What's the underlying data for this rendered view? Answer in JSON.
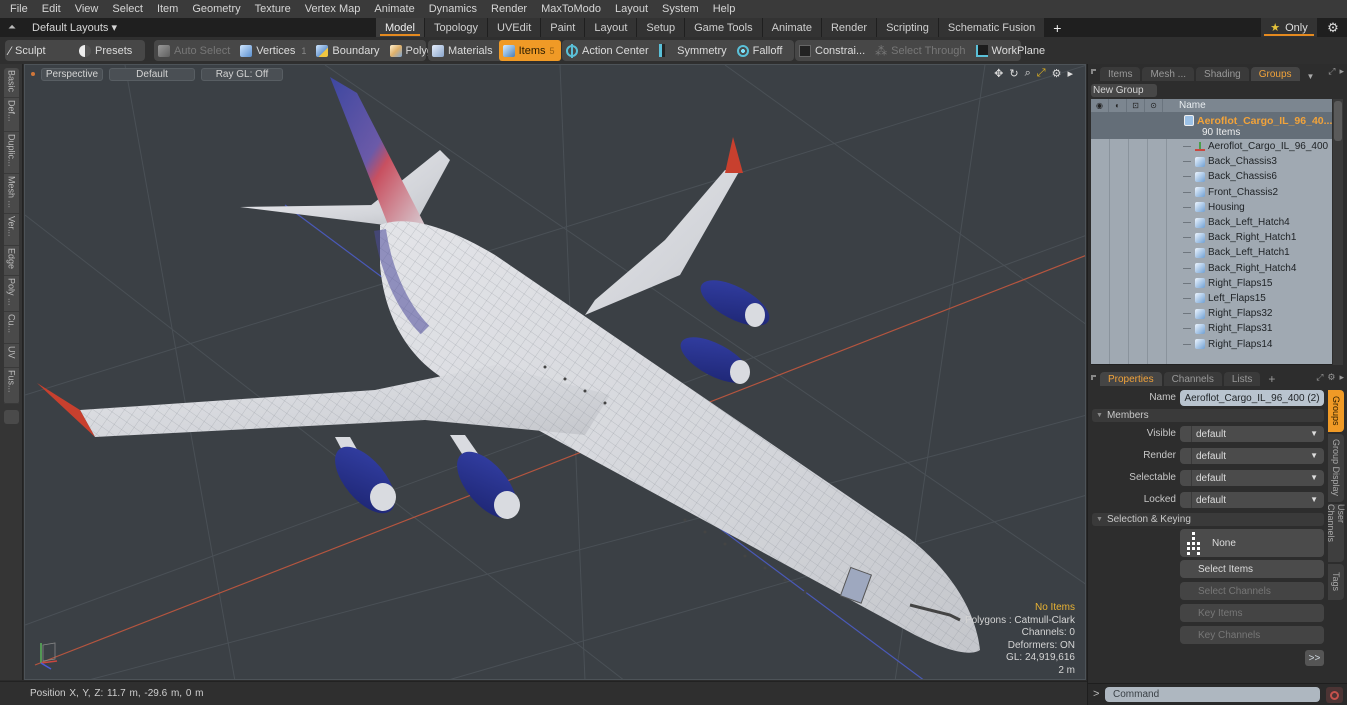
{
  "menu": [
    "File",
    "Edit",
    "View",
    "Select",
    "Item",
    "Geometry",
    "Texture",
    "Vertex Map",
    "Animate",
    "Dynamics",
    "Render",
    "MaxToModo",
    "Layout",
    "System",
    "Help"
  ],
  "layout_bar": {
    "layouts_label": "Default Layouts ▾",
    "tabs": [
      "Model",
      "Topology",
      "UVEdit",
      "Paint",
      "Layout",
      "Setup",
      "Game Tools",
      "Animate",
      "Render",
      "Scripting",
      "Schematic Fusion"
    ],
    "active_tab": "Model",
    "add_label": "+",
    "only_label": "Only",
    "accent_color": "#e58a1f"
  },
  "toolbar": {
    "sculpt": "Sculpt",
    "presets": "Presets",
    "auto_select": "Auto Select",
    "vertices": "Vertices",
    "vertices_count": "1",
    "boundary": "Boundary",
    "polygons": "Polygons",
    "materials": "Materials",
    "items": "Items",
    "items_count": "5",
    "action_center": "Action Center",
    "symmetry": "Symmetry",
    "falloff": "Falloff",
    "constraints": "Constrai...",
    "select_through": "Select Through",
    "workplane": "WorkPlane"
  },
  "left_tabs": [
    "Basic",
    "Def...",
    "Duplic...",
    "Mesh ...",
    "Ver...",
    "Edge",
    "Poly ...",
    "Cu...",
    "UV",
    "Fus..."
  ],
  "viewport": {
    "view_mode": "Perspective",
    "shading": "Default",
    "raygl": "Ray GL: Off",
    "info": {
      "selection": "No Items",
      "polygons": "Polygons : Catmull-Clark",
      "channels": "Channels: 0",
      "deformers": "Deformers: ON",
      "gl": "GL: 24,919,616",
      "scale": "2 m"
    },
    "colors": {
      "background": "#3b4045",
      "fuselage": "#d9dbde",
      "engine": "#26308a",
      "accent_red": "#c8402e",
      "x_axis": "#c2553e",
      "z_axis": "#4a59b8"
    }
  },
  "status": {
    "position": "Position X, Y, Z:   11.7 m, -29.6 m, 0 m"
  },
  "groups_panel": {
    "tabs": [
      "Items",
      "Mesh ...",
      "Shading",
      "Groups"
    ],
    "active_tab": "Groups",
    "new_group": "New Group",
    "name_header": "Name",
    "group_name": "Aeroflot_Cargo_IL_96_40...",
    "group_count": "90 Items",
    "items": [
      {
        "name": "Aeroflot_Cargo_IL_96_400",
        "type": "locator"
      },
      {
        "name": "Back_Chassis3",
        "type": "mesh"
      },
      {
        "name": "Back_Chassis6",
        "type": "mesh"
      },
      {
        "name": "Front_Chassis2",
        "type": "mesh"
      },
      {
        "name": "Housing",
        "type": "mesh"
      },
      {
        "name": "Back_Left_Hatch4",
        "type": "mesh"
      },
      {
        "name": "Back_Right_Hatch1",
        "type": "mesh"
      },
      {
        "name": "Back_Left_Hatch1",
        "type": "mesh"
      },
      {
        "name": "Back_Right_Hatch4",
        "type": "mesh"
      },
      {
        "name": "Right_Flaps15",
        "type": "mesh"
      },
      {
        "name": "Left_Flaps15",
        "type": "mesh"
      },
      {
        "name": "Right_Flaps32",
        "type": "mesh"
      },
      {
        "name": "Right_Flaps31",
        "type": "mesh"
      },
      {
        "name": "Right_Flaps14",
        "type": "mesh"
      }
    ]
  },
  "properties_panel": {
    "tabs": [
      "Properties",
      "Channels",
      "Lists"
    ],
    "active_tab": "Properties",
    "add_label": "+",
    "name_label": "Name",
    "name_value": "Aeroflot_Cargo_IL_96_400 (2)",
    "members_section": "Members",
    "members": [
      {
        "label": "Visible",
        "value": "default"
      },
      {
        "label": "Render",
        "value": "default"
      },
      {
        "label": "Selectable",
        "value": "default"
      },
      {
        "label": "Locked",
        "value": "default"
      }
    ],
    "selection_section": "Selection & Keying",
    "none_label": "None",
    "select_items": "Select Items",
    "select_channels": "Select Channels",
    "key_items": "Key Items",
    "key_channels": "Key Channels",
    "more": ">>",
    "side_tabs": [
      "Groups",
      "Group Display",
      "User Channels",
      "Tags"
    ],
    "active_side_tab": "Groups"
  },
  "command": {
    "prompt": ">",
    "placeholder": "Command"
  }
}
